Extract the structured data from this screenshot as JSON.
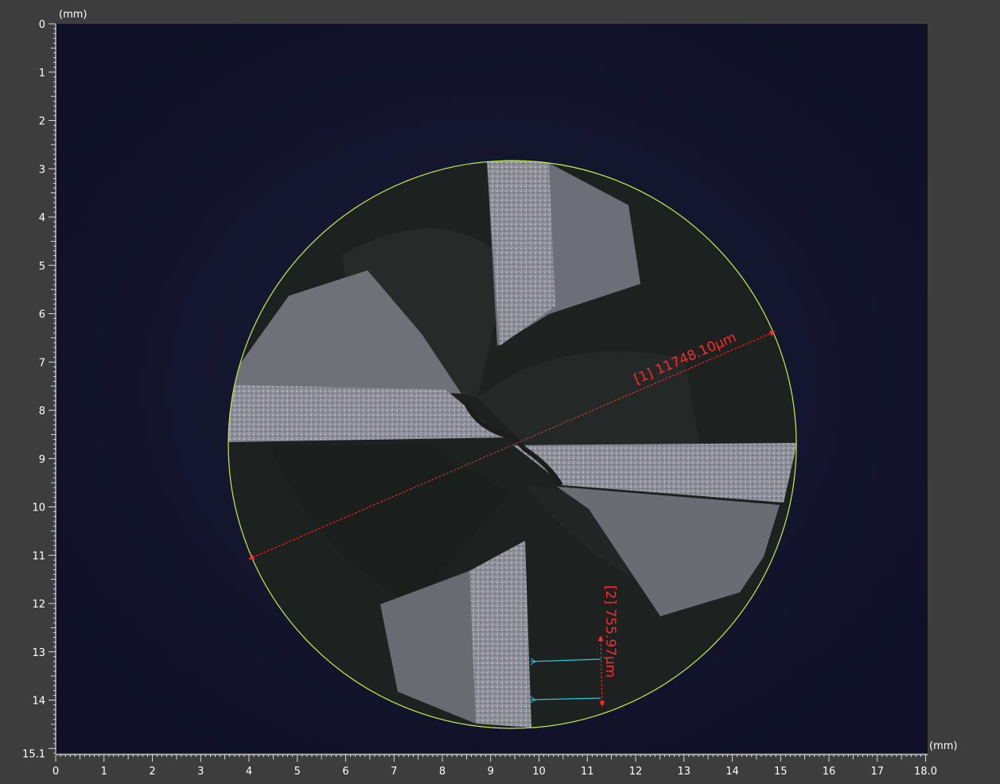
{
  "ruler": {
    "unit": "(mm)",
    "x_ticks": [
      "0",
      "1",
      "2",
      "3",
      "4",
      "5",
      "6",
      "7",
      "8",
      "9",
      "10",
      "11",
      "12",
      "13",
      "14",
      "15",
      "16",
      "17",
      "18.0"
    ],
    "y_ticks": [
      "0",
      "1",
      "2",
      "3",
      "4",
      "5",
      "6",
      "7",
      "8",
      "9",
      "10",
      "11",
      "12",
      "13",
      "14",
      "15.1"
    ],
    "x_range_mm": [
      0,
      18.0
    ],
    "y_range_mm": [
      0,
      15.1
    ]
  },
  "measurements": [
    {
      "label": "[1] 11748.10μm",
      "type": "diameter",
      "color": "#ff2a2a"
    },
    {
      "label": "[2] 755.97μm",
      "type": "width",
      "color": "#ff2a2a",
      "guide_color": "#29c6e0"
    }
  ],
  "colors": {
    "background": "#13142b",
    "frame": "#3d3d3d",
    "fit_circle": "#c8f04a",
    "text": "#ffffff"
  }
}
